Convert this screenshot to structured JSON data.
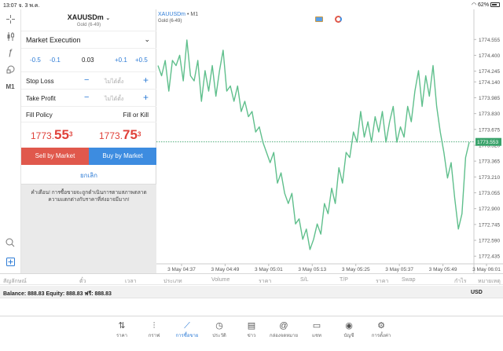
{
  "status": {
    "time": "13:07",
    "date": "จ. 3 พ.ค.",
    "battery": "62%"
  },
  "tools": [
    {
      "name": "crosshair-icon",
      "glyph": "+"
    },
    {
      "name": "candles-icon",
      "glyph": "⫶"
    },
    {
      "name": "indicators-icon",
      "glyph": "ƒ"
    },
    {
      "name": "objects-icon",
      "glyph": "⌂"
    },
    {
      "name": "timeframe-m1",
      "glyph": "M1"
    }
  ],
  "panel": {
    "symbol": "XAUUSDm",
    "symbol_desc": "Gold (6-49)",
    "execution": "Market Execution",
    "volume": {
      "steps_minus": [
        "-0.5",
        "-0.1"
      ],
      "value": "0.03",
      "steps_plus": [
        "+0.1",
        "+0.5"
      ]
    },
    "stop_loss": {
      "label": "Stop Loss",
      "placeholder": "ไม่ได้ตั้ง"
    },
    "take_profit": {
      "label": "Take Profit",
      "placeholder": "ไม่ได้ตั้ง"
    },
    "fill_policy": {
      "label": "Fill Policy",
      "value": "Fill or Kill"
    },
    "bid": {
      "main": "1773.",
      "big": "55",
      "sup": "3"
    },
    "ask": {
      "main": "1773.",
      "big": "75",
      "sup": "3"
    },
    "sell_label": "Sell by Market",
    "buy_label": "Buy by Market",
    "cancel_label": "ยกเลิก",
    "warning": "คำเตือน! การซื้อขายจะถูกดำเนินการตามสภาพตลาด ความแตกต่างกับราคาที่ส่งอาจมีมาก!"
  },
  "chart": {
    "symbol": "XAUUSDm",
    "timeframe": "M1",
    "desc": "Gold (6-49)",
    "price_tag": "1773.553"
  },
  "chart_data": {
    "type": "line",
    "title": "XAUUSDm • M1",
    "x_labels": [
      "3 May 04:37",
      "3 May 04:49",
      "3 May 05:01",
      "3 May 05:13",
      "3 May 05:25",
      "3 May 05:37",
      "3 May 05:49",
      "3 May 06:01"
    ],
    "y_ticks": [
      "1774.555",
      "1774.400",
      "1774.245",
      "1774.140",
      "1773.985",
      "1773.830",
      "1773.675",
      "1773.520",
      "1773.365",
      "1773.210",
      "1773.055",
      "1772.900",
      "1772.745",
      "1772.590",
      "1772.435"
    ],
    "ylim": [
      1772.36,
      1774.68
    ],
    "current": 1773.553,
    "series": [
      {
        "values": [
          1774.3,
          1774.2,
          1774.35,
          1774.05,
          1774.35,
          1774.3,
          1774.4,
          1774.15,
          1774.55,
          1774.2,
          1774.15,
          1774.35,
          1773.95,
          1774.25,
          1774.05,
          1774.3,
          1774.0,
          1774.25,
          1774.45,
          1774.05,
          1774.1,
          1773.95,
          1774.1,
          1773.85,
          1773.95,
          1773.8,
          1773.85,
          1773.65,
          1773.7,
          1773.55,
          1773.45,
          1773.35,
          1773.45,
          1773.15,
          1773.25,
          1773.05,
          1772.95,
          1773.05,
          1772.75,
          1772.8,
          1772.6,
          1772.7,
          1772.5,
          1772.6,
          1772.75,
          1772.65,
          1772.95,
          1772.85,
          1773.1,
          1772.95,
          1773.3,
          1773.15,
          1773.45,
          1773.4,
          1773.65,
          1773.55,
          1773.85,
          1773.6,
          1773.75,
          1773.55,
          1773.8,
          1773.65,
          1773.85,
          1773.55,
          1773.75,
          1773.9,
          1773.55,
          1773.7,
          1773.6,
          1773.9,
          1773.75,
          1774.05,
          1774.25,
          1773.9,
          1774.2,
          1774.0,
          1774.3,
          1773.9,
          1773.65,
          1773.45,
          1773.2,
          1773.35,
          1773.0,
          1772.7,
          1772.85,
          1773.4,
          1773.55
        ]
      }
    ]
  },
  "table_headers": [
    "สัญลักษณ์",
    "ตั๋ว",
    "เวลา",
    "ประเภท",
    "Volume",
    "ราคา",
    "S/L",
    "T/P",
    "ราคา",
    "Swap",
    "กำไร",
    "หมายเหตุ"
  ],
  "balance": {
    "text": "Balance: 888.83 Equity: 888.83 ฟรี: 888.83",
    "currency": "USD"
  },
  "tabs": [
    {
      "name": "tab-quotes",
      "icon": "⇅",
      "label": "ราคา"
    },
    {
      "name": "tab-chart",
      "icon": "⫶",
      "label": "กราฟ"
    },
    {
      "name": "tab-trade",
      "icon": "⟋",
      "label": "การซื้อขาย",
      "active": true
    },
    {
      "name": "tab-history",
      "icon": "◷",
      "label": "ประวัติ"
    },
    {
      "name": "tab-news",
      "icon": "▤",
      "label": "ข่าว"
    },
    {
      "name": "tab-mailbox",
      "icon": "@",
      "label": "กล่องจดหมาย"
    },
    {
      "name": "tab-chat",
      "icon": "▭",
      "label": "แชท"
    },
    {
      "name": "tab-accounts",
      "icon": "◉",
      "label": "บัญชี"
    },
    {
      "name": "tab-settings",
      "icon": "⚙",
      "label": "การตั้งค่า"
    }
  ]
}
